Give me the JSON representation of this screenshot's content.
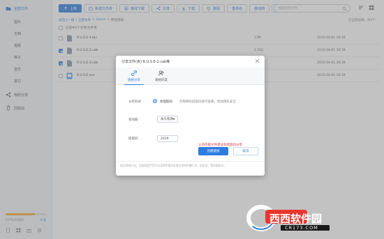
{
  "sidebar": {
    "items": [
      {
        "label": "全部文件",
        "active": true,
        "sub": false
      },
      {
        "label": "图片",
        "sub": true
      },
      {
        "label": "文档",
        "sub": true
      },
      {
        "label": "视频",
        "sub": true
      },
      {
        "label": "种子",
        "sub": true
      },
      {
        "label": "音乐",
        "sub": true
      },
      {
        "label": "其它",
        "sub": true
      },
      {
        "label": "我的分享",
        "sub": false
      },
      {
        "label": "回收站",
        "sub": false
      }
    ],
    "storage": {
      "used_text": "237%/2180G",
      "expand_label": "扩容",
      "fraction": 0.72
    }
  },
  "toolbar": {
    "upload": "上传",
    "new_folder": "新建文件夹",
    "offline": "离线下载",
    "share": "分享",
    "download": "下载",
    "delete": "删除",
    "rename": "重命名",
    "move": "移动到",
    "more": "更多"
  },
  "search": {
    "placeholder": "搜索您的文件"
  },
  "breadcrumb": {
    "back": "返回上一级",
    "root": "全部文件",
    "sep": ">",
    "mid": "Game",
    "current": "所有游戏"
  },
  "loaded_text": "已全部加载，共4个",
  "selection_info": "已选中2个文件/文件夹",
  "files": [
    {
      "name": "R.U.S.E-1.bin",
      "size": "13M",
      "date": "2015-04-01 16:39",
      "checked": false
    },
    {
      "name": "R.U.S.E-2.cab",
      "size": "2.76G",
      "date": "2015-04-01 16:39",
      "checked": true
    },
    {
      "name": "R.U.S.E-3.cab",
      "size": "1.35G",
      "date": "2015-04-01 16:39",
      "checked": true
    },
    {
      "name": "R.U.S.E.exe",
      "size": "",
      "date": "2015-04-01 16:39",
      "checked": false
    }
  ],
  "dialog": {
    "title": "分享文件(夹):R.U.S.E-2.cab等",
    "tabs": [
      "链接分享",
      "发给好友"
    ],
    "share_mode_label": "分享形式",
    "share_mode_value": "有提取码",
    "share_mode_hint": "仅限拥有提取码者可查看，更加隐私安全",
    "validity_label": "有效期",
    "validity_value": "永久有效",
    "code_label": "提取码",
    "code_value": "2019",
    "warning": "公司内部文件建议有提取码分享",
    "create_button": "创建链接",
    "cancel_button": "取消",
    "footer": "配合净网行动，百度网盘严厉打击淫秽色情及低俗信息的传播行为，如发现，将封禁账号。"
  },
  "watermark": {
    "brand": "西西软件园",
    "url": "CR173.COM"
  },
  "colors": {
    "accent": "#2d7de0",
    "warning": "#d9363e",
    "storage": "#f2a930"
  }
}
